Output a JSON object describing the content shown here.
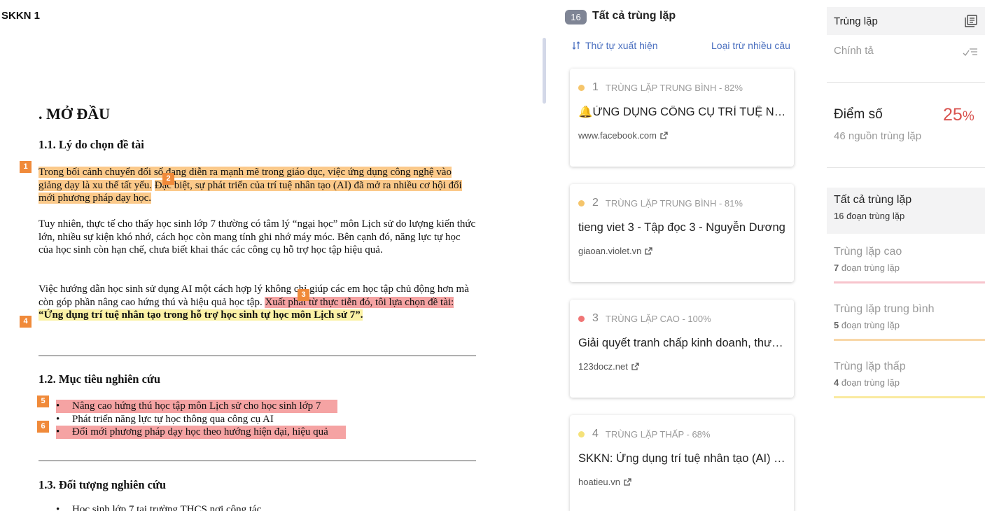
{
  "document": {
    "title": "SKKN 1",
    "heading": ". MỞ ĐẦU",
    "section_1_1": "1.1. Lý do chọn đề tài",
    "para1_hl1": "Trong bối cảnh chuyển đổi số đang diễn ra mạnh mẽ trong giáo dục, việc ứng dụng công nghệ vào giảng dạy là xu thế tất yếu.",
    "para1_hl2": "Đặc biệt, sự phát triển của trí tuệ nhân tạo (AI) đã mở ra nhiều cơ hội đổi mới phương pháp dạy học.",
    "para2": "Tuy nhiên, thực tế cho thấy học sinh lớp 7 thường có tâm lý “ngại học” môn Lịch sử do lượng kiến thức lớn, nhiều sự kiện khó nhớ, cách học còn mang tính ghi nhớ máy móc. Bên cạnh đó, năng lực tự học của học sinh còn hạn chế, chưa biết khai thác các công cụ hỗ trợ học tập hiệu quả.",
    "para3_plain": "Việc hướng dẫn học sinh sử dụng AI một cách hợp lý không chỉ giúp các em học tập chủ động hơn mà còn góp phần nâng cao hứng thú và hiệu quả học tập.",
    "para3_hl": "Xuất phát từ thực tiễn đó, tôi lựa chọn đề tài:",
    "para3_quote": "“Ứng dụng trí tuệ nhân tạo trong hỗ trợ học sinh tự học môn Lịch sử 7”.",
    "section_1_2": "1.2. Mục tiêu nghiên cứu",
    "goals": [
      "Nâng cao hứng thú học tập môn Lịch sử cho học sinh lớp 7",
      "Phát triển năng lực tự học thông qua công cụ AI",
      "Đổi mới phương pháp dạy học theo hướng hiện đại, hiệu quả"
    ],
    "section_1_3": "1.3. Đối tượng nghiên cứu",
    "objects": [
      "Học sinh lớp 7 tại trường THCS nơi công tác"
    ],
    "markers": [
      "1",
      "2",
      "3",
      "4",
      "5",
      "6"
    ]
  },
  "results": {
    "count": "16",
    "title": "Tất cả trùng lặp",
    "sort_label": "Thứ tự xuất hiện",
    "exclude_label": "Loại trừ nhiều câu",
    "cards": [
      {
        "num": "1",
        "level": "TRÙNG LẶP TRUNG BÌNH - 82%",
        "title": "🔔ỨNG DỤNG CÔNG CỤ TRÍ TUỆ NHÂN TẠO",
        "source": "www.facebook.com",
        "color": "#f5c56b"
      },
      {
        "num": "2",
        "level": "TRÙNG LẶP TRUNG BÌNH - 81%",
        "title": "tieng viet 3 - Tập đọc 3 - Nguyễn Dương",
        "source": "giaoan.violet.vn",
        "color": "#f5c56b"
      },
      {
        "num": "3",
        "level": "TRÙNG LẶP CAO - 100%",
        "title": "Giải quyết tranh chấp kinh doanh, thương mại",
        "source": "123docz.net",
        "color": "#f07575"
      },
      {
        "num": "4",
        "level": "TRÙNG LẶP THẤP - 68%",
        "title": "SKKN: Ứng dụng trí tuệ nhân tạo (AI) nhằm",
        "source": "hoatieu.vn",
        "color": "#f5e27a"
      }
    ]
  },
  "sidebar": {
    "tab_duplicate": "Trùng lặp",
    "tab_spelling": "Chính tả",
    "score_label": "Điểm số",
    "score_value": "25",
    "score_unit": "%",
    "score_sub": "46 nguồn trùng lặp",
    "categories": [
      {
        "name": "Tất cả trùng lặp",
        "count": "16",
        "suffix": "đoạn trùng lặp",
        "color": ""
      },
      {
        "name": "Trùng lặp cao",
        "count": "7",
        "suffix": "đoạn trùng lặp",
        "color": "#f7c4cc"
      },
      {
        "name": "Trùng lặp trung bình",
        "count": "5",
        "suffix": "đoạn trùng lặp",
        "color": "#f8d7a8"
      },
      {
        "name": "Trùng lặp thấp",
        "count": "4",
        "suffix": "đoạn trùng lặp",
        "color": "#faeaa0"
      }
    ]
  },
  "colors": {
    "accent_link": "#4a6fbf",
    "score_red": "#d9534f",
    "marker_orange": "#f08a3a"
  }
}
